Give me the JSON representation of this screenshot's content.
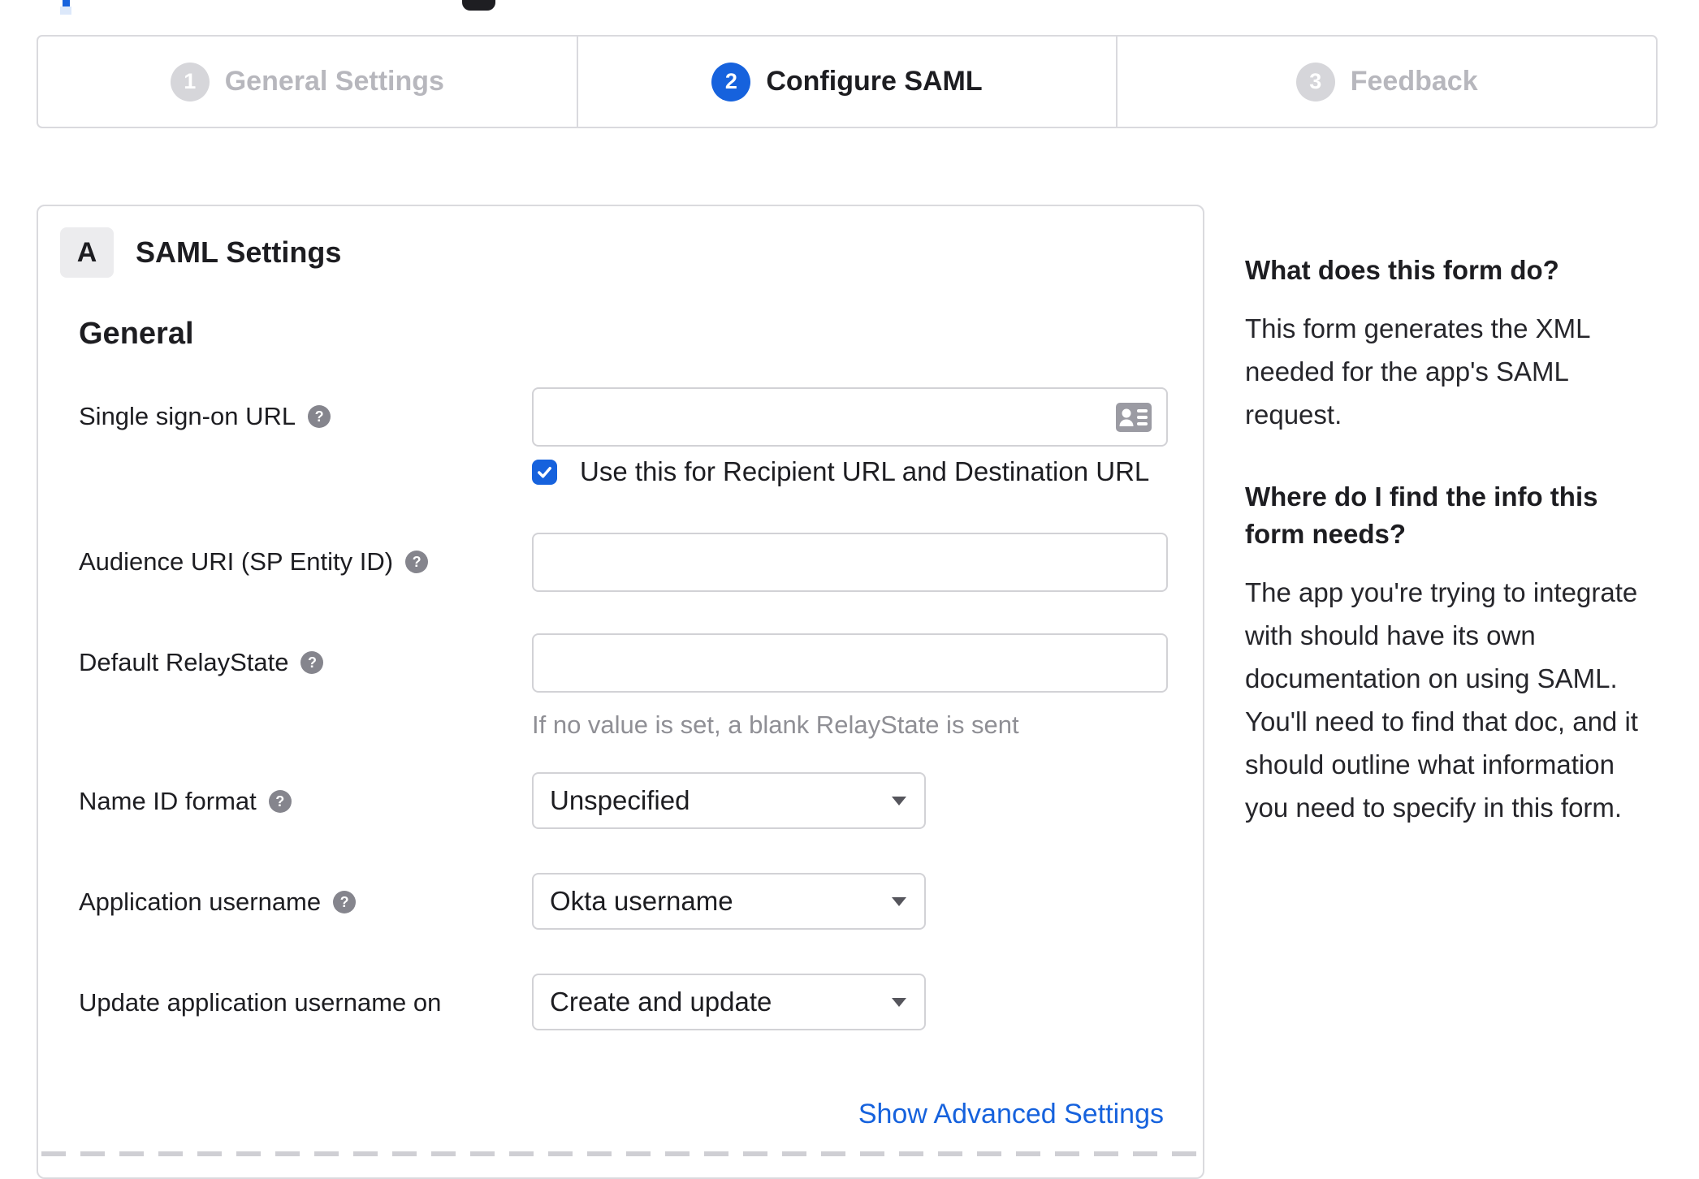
{
  "colors": {
    "accent": "#1662dd",
    "step_inactive_circle": "#d6d6da",
    "text_dark": "#1d1d21",
    "text_inactive": "#b7b7bd",
    "hint_gray": "#8f8f95",
    "border_gray": "#dadade",
    "icon_gray": "#9b9ba3",
    "badge_bg": "#ececee"
  },
  "stepper": {
    "steps": [
      {
        "number": "1",
        "label": "General Settings",
        "state": "inactive"
      },
      {
        "number": "2",
        "label": "Configure SAML",
        "state": "active"
      },
      {
        "number": "3",
        "label": "Feedback",
        "state": "inactive"
      }
    ]
  },
  "card": {
    "section_badge": "A",
    "section_title": "SAML Settings",
    "group_heading": "General",
    "advanced_link": "Show Advanced Settings"
  },
  "form": {
    "fields": [
      {
        "slug": "sso-url",
        "label": "Single sign-on URL",
        "has_help": true,
        "type": "text",
        "value": "",
        "trailing_icon": "contact-card",
        "checkbox": {
          "checked": true,
          "label": "Use this for Recipient URL and Destination URL"
        },
        "row_class": "mb-row1"
      },
      {
        "slug": "audience-uri",
        "label": "Audience URI (SP Entity ID)",
        "has_help": true,
        "type": "text",
        "value": "",
        "row_class": "mb-row2"
      },
      {
        "slug": "default-relaystate",
        "label": "Default RelayState",
        "has_help": true,
        "type": "text",
        "value": "",
        "hint": "If no value is set, a blank RelayState is sent",
        "row_class": "mb-row3"
      },
      {
        "slug": "name-id-format",
        "label": "Name ID format",
        "has_help": true,
        "type": "select",
        "value": "Unspecified",
        "row_class": "mb-row4"
      },
      {
        "slug": "application-username",
        "label": "Application username",
        "has_help": true,
        "type": "select",
        "value": "Okta username",
        "row_class": "mb-row5"
      },
      {
        "slug": "update-application-username",
        "label": "Update application username on",
        "has_help": false,
        "type": "select",
        "value": "Create and update",
        "row_class": "mb-row6"
      }
    ]
  },
  "sidebar": {
    "heading1": "What does this form do?",
    "para1": "This form generates the XML needed for the app's SAML request.",
    "heading2": "Where do I find the info this form needs?",
    "para2": "The app you're trying to integrate with should have its own documentation on using SAML. You'll need to find that doc, and it should outline what information you need to specify in this form."
  }
}
